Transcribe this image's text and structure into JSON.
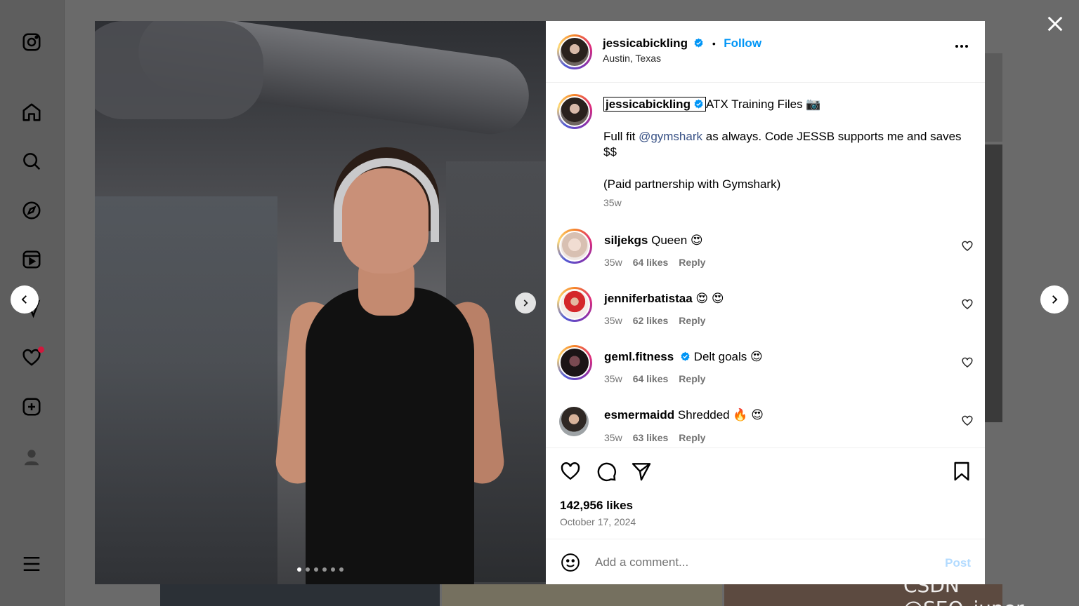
{
  "sidebar": {
    "icons": [
      "instagram-logo-icon",
      "home-icon",
      "search-icon",
      "explore-icon",
      "reels-icon",
      "messages-icon",
      "notifications-icon",
      "create-icon",
      "profile-icon",
      "menu-icon"
    ]
  },
  "post": {
    "username": "jessicabickling",
    "location": "Austin, Texas",
    "follow_label": "Follow",
    "separator": "•",
    "caption_title": "ATX Training Files 📷",
    "caption_line1_a": "Full fit ",
    "caption_mention": "@gymshark",
    "caption_line1_b": " as always. Code JESSB supports me and saves $$",
    "caption_line2": "(Paid partnership with Gymshark)",
    "caption_time": "35w",
    "likes": "142,956 likes",
    "date": "October 17, 2024",
    "media_pages": 6,
    "media_active_page": 1
  },
  "comments": [
    {
      "username": "siljekgs",
      "text": "Queen 😍",
      "time": "35w",
      "likes": "64 likes",
      "reply": "Reply",
      "verified": false
    },
    {
      "username": "jenniferbatistaa",
      "text": "😍 😍",
      "time": "35w",
      "likes": "62 likes",
      "reply": "Reply",
      "verified": false
    },
    {
      "username": "geml.fitness",
      "text": "Delt goals 😍",
      "time": "35w",
      "likes": "64 likes",
      "reply": "Reply",
      "verified": true
    },
    {
      "username": "esmermaidd",
      "text": "Shredded 🔥 😍",
      "time": "35w",
      "likes": "63 likes",
      "reply": "Reply",
      "verified": false
    }
  ],
  "compose": {
    "placeholder": "Add a comment...",
    "post_label": "Post"
  },
  "colors": {
    "accent": "#0095f6",
    "mention": "#385185",
    "muted": "#737373",
    "notification": "#d0193d"
  },
  "watermark": "CSDN @SEO_juper"
}
